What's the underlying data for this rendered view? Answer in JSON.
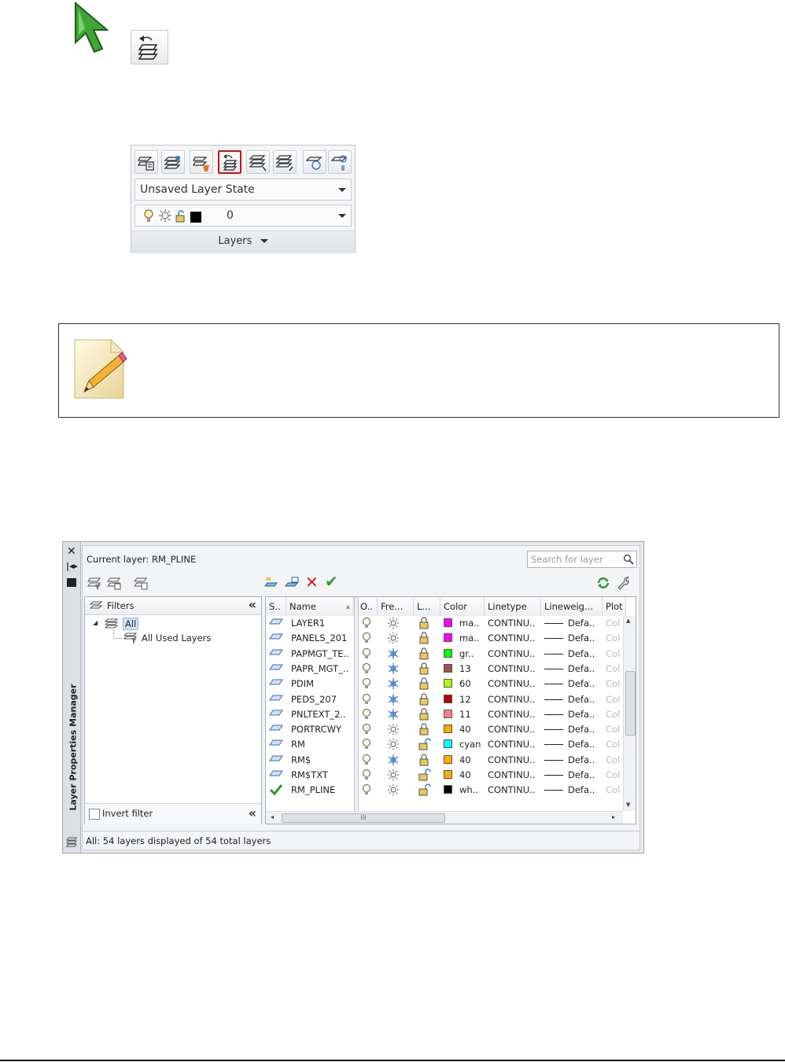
{
  "ribbon": {
    "state_combo": "Unsaved Layer State",
    "layer_combo": "0",
    "panel_title": "Layers"
  },
  "lpm": {
    "title_vertical": "Layer Properties Manager",
    "current_layer": "Current layer: RM_PLINE",
    "search_placeholder": "Search for layer",
    "filters_label": "Filters",
    "tree_all": "All",
    "tree_used": "All Used Layers",
    "invert_filter": "Invert filter",
    "status": "All: 54 layers displayed of 54 total layers",
    "columns": [
      "S..",
      "Name",
      "O..",
      "Fre...",
      "L...",
      "Color",
      "Linetype",
      "Lineweig...",
      "Plot"
    ],
    "scroll_marker": "III",
    "rows": [
      {
        "name": "LAYER1",
        "freeze": "sun",
        "lock": "locked",
        "color": "#ff00ff",
        "color_name": "ma..",
        "linetype": "CONTINU..",
        "lineweight": "Defa..",
        "plot": "Col",
        "current": false
      },
      {
        "name": "PANELS_201",
        "freeze": "sun",
        "lock": "locked",
        "color": "#ff00ff",
        "color_name": "ma..",
        "linetype": "CONTINU..",
        "lineweight": "Defa..",
        "plot": "Col",
        "current": false
      },
      {
        "name": "PAPMGT_TE..",
        "freeze": "snow",
        "lock": "locked",
        "color": "#00ff00",
        "color_name": "gr..",
        "linetype": "CONTINU..",
        "lineweight": "Defa..",
        "plot": "Col",
        "current": false
      },
      {
        "name": "PAPR_MGT_..",
        "freeze": "snow",
        "lock": "locked",
        "color": "#a0524d",
        "color_name": "13",
        "linetype": "CONTINU..",
        "lineweight": "Defa..",
        "plot": "Col",
        "current": false
      },
      {
        "name": "PDIM",
        "freeze": "snow",
        "lock": "locked",
        "color": "#aaff00",
        "color_name": "60",
        "linetype": "CONTINU..",
        "lineweight": "Defa..",
        "plot": "Col",
        "current": false
      },
      {
        "name": "PEDS_207",
        "freeze": "snow",
        "lock": "locked",
        "color": "#bb0000",
        "color_name": "12",
        "linetype": "CONTINU..",
        "lineweight": "Defa..",
        "plot": "Col",
        "current": false
      },
      {
        "name": "PNLTEXT_2..",
        "freeze": "snow",
        "lock": "locked",
        "color": "#ff7f7f",
        "color_name": "11",
        "linetype": "CONTINU..",
        "lineweight": "Defa..",
        "plot": "Col",
        "current": false
      },
      {
        "name": "PORTRCWY",
        "freeze": "sun",
        "lock": "locked",
        "color": "#ffaa00",
        "color_name": "40",
        "linetype": "CONTINU..",
        "lineweight": "Defa..",
        "plot": "Col",
        "current": false
      },
      {
        "name": "RM",
        "freeze": "sun",
        "lock": "unlocked",
        "color": "#00ffff",
        "color_name": "cyan",
        "linetype": "CONTINU..",
        "lineweight": "Defa..",
        "plot": "Col",
        "current": false
      },
      {
        "name": "RM$",
        "freeze": "snow",
        "lock": "locked",
        "color": "#ffaa00",
        "color_name": "40",
        "linetype": "CONTINU..",
        "lineweight": "Defa..",
        "plot": "Col",
        "current": false
      },
      {
        "name": "RM$TXT",
        "freeze": "sun",
        "lock": "unlocked",
        "color": "#ffaa00",
        "color_name": "40",
        "linetype": "CONTINU..",
        "lineweight": "Defa..",
        "plot": "Col",
        "current": false
      },
      {
        "name": "RM_PLINE",
        "freeze": "sun",
        "lock": "unlocked",
        "color": "#000000",
        "color_name": "wh..",
        "linetype": "CONTINU..",
        "lineweight": "Defa..",
        "plot": "Col",
        "current": true
      }
    ]
  },
  "colors": {
    "accent_red": "#cc1111",
    "cursor_green": "#3fa535",
    "current_check": "#2e9a2e"
  }
}
